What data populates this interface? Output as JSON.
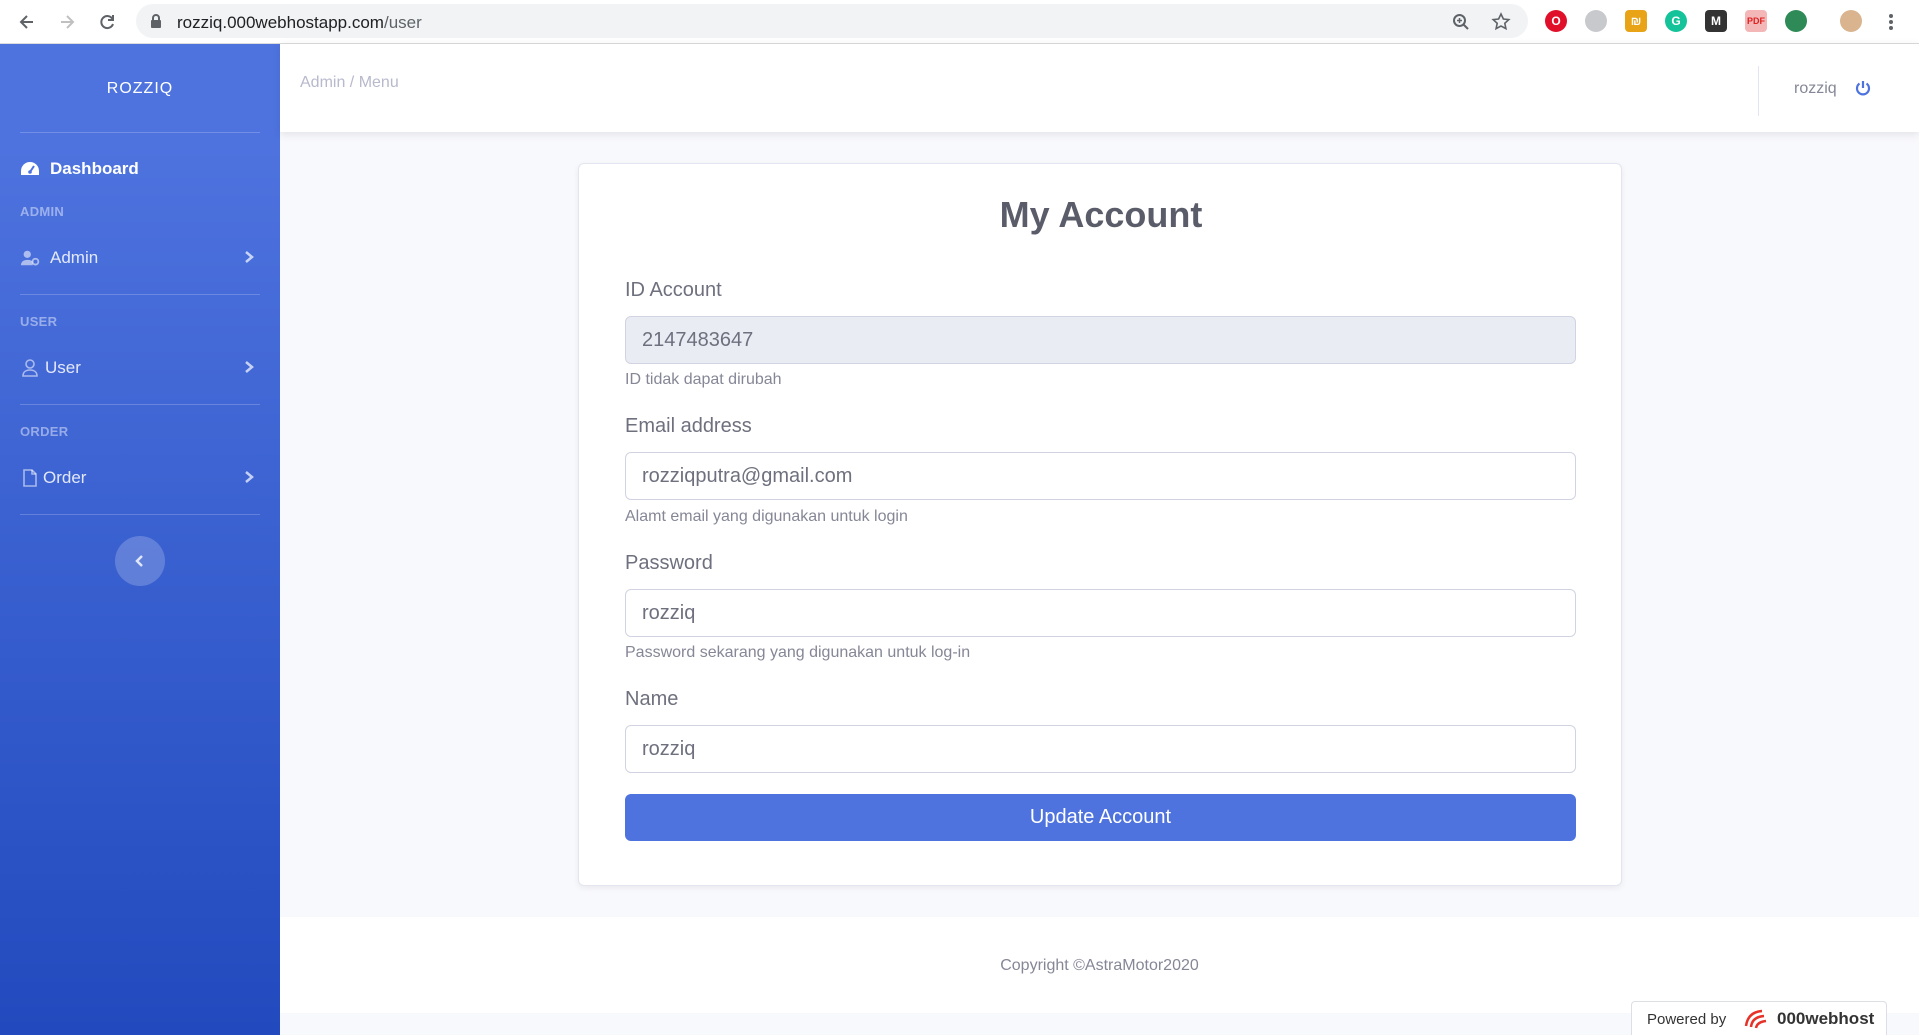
{
  "browser": {
    "url_host": "rozziq.000webhostapp.com",
    "url_path": "/user"
  },
  "sidebar": {
    "brand": "ROZZIQ",
    "dashboard_label": "Dashboard",
    "sections": [
      {
        "heading": "ADMIN",
        "item": "Admin"
      },
      {
        "heading": "USER",
        "item": "User"
      },
      {
        "heading": "ORDER",
        "item": "Order"
      }
    ]
  },
  "topbar": {
    "breadcrumb": "Admin / Menu",
    "username": "rozziq"
  },
  "card": {
    "title": "My Account",
    "fields": [
      {
        "label": "ID Account",
        "value": "2147483647",
        "help": "ID tidak dapat dirubah"
      },
      {
        "label": "Email address",
        "value": "rozziqputra@gmail.com",
        "help": "Alamt email yang digunakan untuk login"
      },
      {
        "label": "Password",
        "value": "rozziq",
        "help": "Password sekarang yang digunakan untuk log-in"
      },
      {
        "label": "Name",
        "value": "rozziq"
      }
    ],
    "submit_label": "Update Account"
  },
  "footer": {
    "copyright": "Copyright ©AstraMotor2020",
    "powered_by": "Powered by",
    "host_name": "000webhost"
  },
  "colors": {
    "primary": "#4e73df",
    "sidebar_end": "#224abe",
    "text_muted": "#858796"
  }
}
